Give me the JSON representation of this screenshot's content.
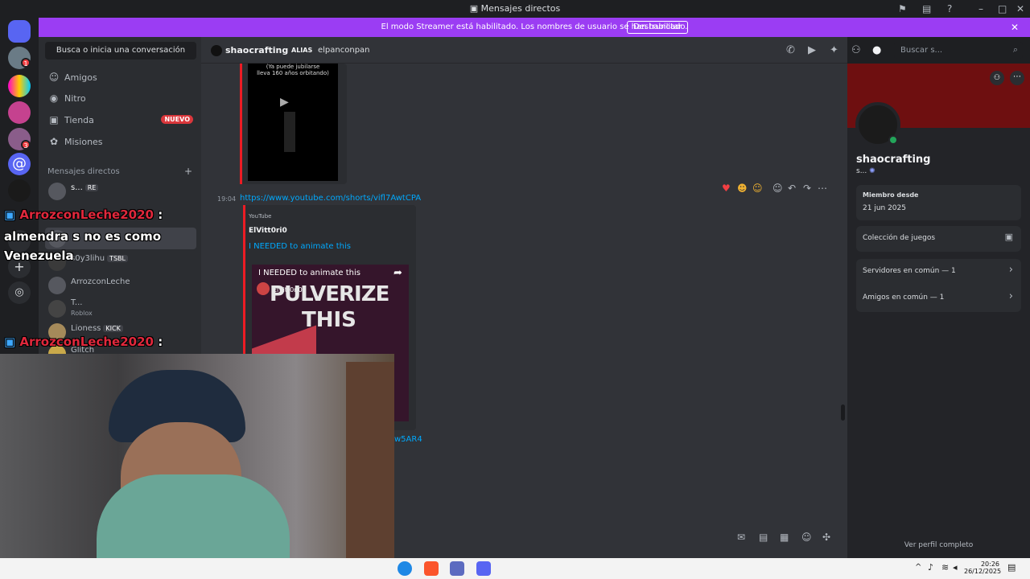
{
  "titlebar": {
    "title": "Mensajes directos"
  },
  "banner": {
    "text": "El modo Streamer está habilitado. Los nombres de usuario se han truncado.",
    "button": "Deshabilitar"
  },
  "guilds": {
    "badges": [
      "1",
      "3"
    ]
  },
  "sidebar": {
    "search": "Busca o inicia una conversación",
    "nav": [
      {
        "label": "Amigos",
        "icon": "friends-icon"
      },
      {
        "label": "Nitro",
        "icon": "nitro-icon"
      },
      {
        "label": "Tienda",
        "icon": "shop-icon",
        "badge": "NUEVO"
      },
      {
        "label": "Misiones",
        "icon": "quests-icon"
      }
    ],
    "dm_header": "Mensajes directos",
    "dms": [
      {
        "name": "s...",
        "tag": "RE"
      },
      {
        "name": "s0y3lihu",
        "tag": "TSBL"
      },
      {
        "name": "ArrozconLeche"
      },
      {
        "name": "T...",
        "sub": "Roblox"
      },
      {
        "name": "Lioness",
        "tag": "KICK"
      },
      {
        "name": "Glitch"
      }
    ]
  },
  "channel": {
    "name": "shaocrafting",
    "alias_label": "ALIAS",
    "alias_value": "elpanconpan",
    "search_placeholder": "Buscar s..."
  },
  "messages": {
    "video1_caption": "(Ya puede jubilarse\nlleva 160 años orbitando)",
    "time": "19:04",
    "link": "https://www.youtube.com/shorts/vifl7AwtCPA",
    "embed_provider": "YouTube",
    "embed_author": "ElVitt0ri0",
    "embed_title": "I NEEDED to animate this",
    "thumb_title": "I NEEDED to animate this",
    "thumb_channel": "ElVitt0ri0",
    "thumb_text1": "PULVERIZE",
    "thumb_text2": "THIS",
    "link2_tail": "w5AR4"
  },
  "profile": {
    "name": "shaocrafting",
    "status": "s...",
    "member_since_label": "Miembro desde",
    "member_since": "21 jun 2025",
    "games": "Colección de juegos",
    "servers": "Servidores en común — 1",
    "friends": "Amigos en común — 1",
    "full": "Ver perfil completo"
  },
  "overlay": {
    "chat1_name": "ArrozconLeche2020",
    "chat1_colon": ":",
    "chat1_text_line1": "almendra s no es como",
    "chat1_text_line2": "Venezuela",
    "chat2_name": "ArrozconLeche2020",
    "chat2_colon": ":"
  },
  "taskbar": {
    "time": "20:26",
    "date": "26/12/2025"
  },
  "colors": {
    "accent": "#9b3df3",
    "brand": "#5865f2",
    "online": "#23a55a",
    "danger": "#da373c",
    "link": "#00a8fc"
  }
}
